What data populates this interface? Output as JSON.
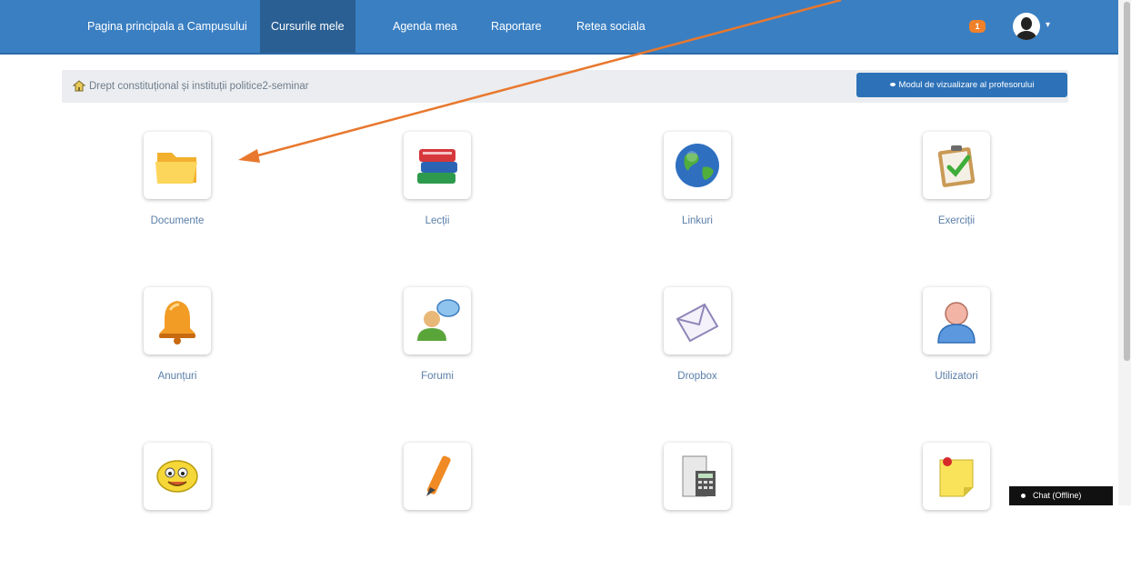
{
  "navbar": {
    "items": [
      {
        "label": "Pagina principala a Campusului"
      },
      {
        "label": "Cursurile mele"
      },
      {
        "label": "Agenda mea"
      },
      {
        "label": "Raportare"
      },
      {
        "label": "Retea sociala"
      }
    ],
    "active_index": 1,
    "notification_count": "1"
  },
  "breadcrumb": {
    "icon": "home-icon",
    "course": "Drept constituțional și instituții politice2-seminar"
  },
  "teacher_view_button": "Modul de vizualizare al profesorului",
  "tools": [
    {
      "label": "Documente",
      "icon": "folder-icon"
    },
    {
      "label": "Lecții",
      "icon": "books-icon"
    },
    {
      "label": "Linkuri",
      "icon": "globe-icon"
    },
    {
      "label": "Exerciții",
      "icon": "checklist-icon"
    },
    {
      "label": "Anunțuri",
      "icon": "bell-icon"
    },
    {
      "label": "Forumi",
      "icon": "forum-users-icon"
    },
    {
      "label": "Dropbox",
      "icon": "envelope-icon"
    },
    {
      "label": "Utilizatori",
      "icon": "user-icon"
    },
    {
      "label": "",
      "icon": "smiley-chat-icon"
    },
    {
      "label": "",
      "icon": "pencil-icon"
    },
    {
      "label": "",
      "icon": "calculator-icon"
    },
    {
      "label": "",
      "icon": "sticky-note-icon"
    }
  ],
  "chat": {
    "label": "Chat (Offline)"
  },
  "colors": {
    "navbar": "#3a7fc2",
    "navbar_active": "#2a5f93",
    "annotation_arrow": "#e8782e",
    "link_label": "#5a7ea8"
  }
}
